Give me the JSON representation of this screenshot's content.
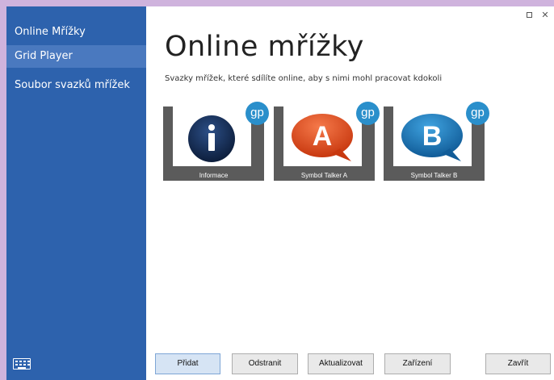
{
  "sidebar": {
    "items": [
      {
        "label": "Online Mřížky",
        "active": false
      },
      {
        "label": "Grid Player",
        "active": true
      },
      {
        "label": "Soubor svazků mřížek",
        "active": false
      }
    ],
    "keyboard_icon": "keyboard-icon"
  },
  "window_controls": {
    "maximize_icon": "maximize-icon",
    "close_glyph": "✕"
  },
  "main": {
    "title": "Online mřížky",
    "subtitle": "Svazky mřížek, které sdílíte online, aby s nimi mohl pracovat kdokoli",
    "tiles": [
      {
        "caption": "Informace",
        "badge": "gp",
        "glyph": "i",
        "color": "#142d55"
      },
      {
        "caption": "Symbol Talker A",
        "badge": "gp",
        "glyph": "A",
        "color": "#e04a1f"
      },
      {
        "caption": "Symbol Talker B",
        "badge": "gp",
        "glyph": "B",
        "color": "#1a7fc4"
      }
    ]
  },
  "footer": {
    "add_label": "Přidat",
    "remove_label": "Odstranit",
    "update_label": "Aktualizovat",
    "device_label": "Zařízení",
    "close_label": "Zavřít"
  },
  "colors": {
    "sidebar_bg": "#2d62ad",
    "sidebar_active": "#4a79bf",
    "badge": "#2a8fcb",
    "tile_bg": "#5b5b5b"
  }
}
